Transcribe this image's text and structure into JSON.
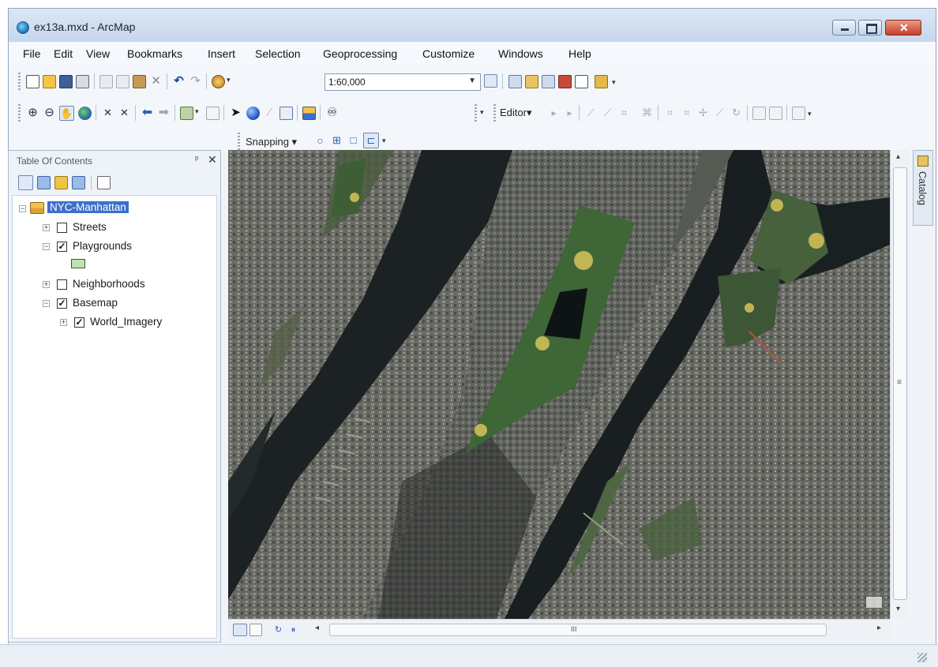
{
  "window": {
    "title": "ex13a.mxd - ArcMap",
    "controls": {
      "minimize": "–",
      "maximize": "□",
      "close": "✕"
    }
  },
  "menu": [
    "File",
    "Edit",
    "View",
    "Bookmarks",
    "Insert",
    "Selection",
    "Geoprocessing",
    "Customize",
    "Windows",
    "Help"
  ],
  "toolbar": {
    "scale_value": "1:60,000",
    "editor_label": "Editor▾",
    "snapping_label": "Snapping ▾"
  },
  "toc": {
    "title": "Table Of Contents",
    "pin_glyph": "ᵖ",
    "close_glyph": "✕",
    "layers": [
      {
        "label": "NYC-Manhattan",
        "expander": "−",
        "selected": true
      },
      {
        "label": "Streets",
        "expander": "+",
        "check": ""
      },
      {
        "label": "Playgrounds",
        "expander": "−",
        "check": "✓"
      },
      {
        "label": "Neighborhoods",
        "expander": "+",
        "check": ""
      },
      {
        "label": "Basemap",
        "expander": "−",
        "check": "✓"
      },
      {
        "label": "World_Imagery",
        "expander": "+",
        "check": "✓"
      }
    ],
    "legend_symbol_color": "#bfe3b0"
  },
  "catalog_tab": "Catalog",
  "scrollbar": {
    "h_glyph": "III",
    "v_glyph": "≡",
    "left_arrow": "◂",
    "right_arrow": "▸",
    "up_arrow": "▴",
    "down_arrow": "▾"
  },
  "colors": {
    "title_bar": "#c6d7ec",
    "selection": "#3d6fcb",
    "water": "#1d2324",
    "park": "#3f6636",
    "city": "#6b6d68",
    "playground": "#d6c45a"
  }
}
